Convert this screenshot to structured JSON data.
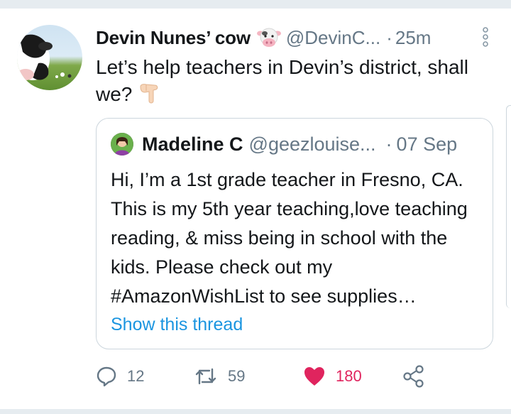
{
  "tweet": {
    "author_name": "Devin Nunes’ cow",
    "author_emoji": "cow-face-icon",
    "handle": "@DevinC...",
    "separator": "·",
    "time": "25m",
    "text": "Let’s help teachers in Devin’s district, shall we?",
    "text_emoji": "pointing-down-hand-icon"
  },
  "quoted_tweet": {
    "author_name": "Madeline C",
    "handle": "@geezlouise...",
    "separator": "·",
    "time": "07 Sep",
    "text": "Hi, I’m a 1st grade teacher in Fresno, CA. This is my 5th year teaching,love teaching reading, & miss being in school with the kids. Please check out my #AmazonWishList to see supplies…",
    "show_thread": "Show this thread"
  },
  "actions": {
    "reply_count": "12",
    "retweet_count": "59",
    "like_count": "180",
    "like_active": true
  },
  "colors": {
    "secondary_text": "#657786",
    "link": "#1b95e0",
    "like": "#e0245e",
    "border": "#ccd6dd"
  }
}
